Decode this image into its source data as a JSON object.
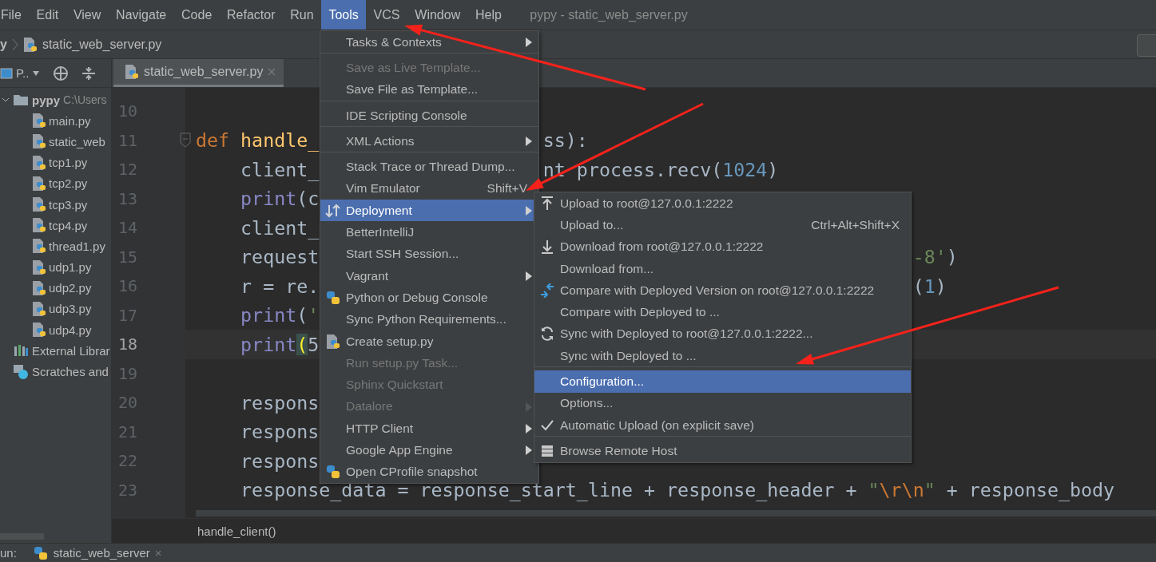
{
  "menu_bar": {
    "items": [
      {
        "label": "File",
        "selected": false
      },
      {
        "label": "Edit",
        "selected": false
      },
      {
        "label": "View",
        "selected": false
      },
      {
        "label": "Navigate",
        "selected": false
      },
      {
        "label": "Code",
        "selected": false
      },
      {
        "label": "Refactor",
        "selected": false
      },
      {
        "label": "Run",
        "selected": false
      },
      {
        "label": "Tools",
        "selected": true
      },
      {
        "label": "VCS",
        "selected": false
      },
      {
        "label": "Window",
        "selected": false
      },
      {
        "label": "Help",
        "selected": false
      }
    ],
    "window_title": "pypy - static_web_server.py"
  },
  "navigation_bar": {
    "path": [
      "y",
      "static_web_server.py"
    ]
  },
  "project_panel": {
    "title": "P..",
    "tree": [
      {
        "label": "pypy",
        "path": "C:\\Users",
        "kind": "folder",
        "expanded": true,
        "children": [
          {
            "label": "main.py",
            "kind": "python"
          },
          {
            "label": "static_web",
            "kind": "python"
          },
          {
            "label": "tcp1.py",
            "kind": "python"
          },
          {
            "label": "tcp2.py",
            "kind": "python"
          },
          {
            "label": "tcp3.py",
            "kind": "python"
          },
          {
            "label": "tcp4.py",
            "kind": "python"
          },
          {
            "label": "thread1.py",
            "kind": "python"
          },
          {
            "label": "udp1.py",
            "kind": "python"
          },
          {
            "label": "udp2.py",
            "kind": "python"
          },
          {
            "label": "udp3.py",
            "kind": "python"
          },
          {
            "label": "udp4.py",
            "kind": "python"
          }
        ]
      },
      {
        "label": "External Librar",
        "kind": "library"
      },
      {
        "label": "Scratches and",
        "kind": "scratches"
      }
    ]
  },
  "editor_tabs": [
    {
      "label": "static_web_server.py",
      "selected": true
    }
  ],
  "code_lines": [
    {
      "number": "10",
      "current": false
    },
    {
      "number": "11",
      "current": false,
      "left": [
        {
          "text": "def",
          "kind": "keyword"
        },
        {
          "text": "handle_",
          "kind": "function"
        }
      ],
      "right": [
        {
          "text": "ss):",
          "kind": "plain"
        }
      ]
    },
    {
      "number": "12",
      "current": false,
      "left": [
        {
          "text": "client_",
          "kind": "plain"
        }
      ],
      "right": [
        {
          "text": "nt process.recv(",
          "kind": "plain"
        },
        {
          "text": "1024",
          "kind": "number"
        },
        {
          "text": ")",
          "kind": "plain"
        }
      ]
    },
    {
      "number": "13",
      "current": false,
      "left": [
        {
          "text": "print",
          "kind": "builtin"
        },
        {
          "text": "(c",
          "kind": "plain"
        }
      ]
    },
    {
      "number": "14",
      "current": false,
      "left": [
        {
          "text": "client_",
          "kind": "plain"
        }
      ]
    },
    {
      "number": "15",
      "current": false,
      "left": [
        {
          "text": "request",
          "kind": "plain"
        }
      ],
      "right": [
        {
          "text": "-8'",
          "kind": "string"
        },
        {
          "text": ")",
          "kind": "plain"
        }
      ]
    },
    {
      "number": "16",
      "current": false,
      "left": [
        {
          "text": "r = re.",
          "kind": "plain"
        }
      ],
      "right": [
        {
          "text": "(",
          "kind": "plain"
        },
        {
          "text": "1",
          "kind": "number"
        },
        {
          "text": ")",
          "kind": "plain"
        }
      ]
    },
    {
      "number": "17",
      "current": false,
      "left": [
        {
          "text": "print",
          "kind": "builtin"
        },
        {
          "text": "(",
          "kind": "plain"
        },
        {
          "text": "'",
          "kind": "string"
        }
      ]
    },
    {
      "number": "18",
      "current": true,
      "left": [
        {
          "text": "print",
          "kind": "builtin"
        },
        {
          "text": "(",
          "kind": "brace"
        },
        {
          "text": "5",
          "kind": "plain"
        }
      ]
    },
    {
      "number": "19",
      "current": false
    },
    {
      "number": "20",
      "current": false,
      "left": [
        {
          "text": "respons",
          "kind": "plain"
        }
      ]
    },
    {
      "number": "21",
      "current": false,
      "left": [
        {
          "text": "respons",
          "kind": "plain"
        }
      ]
    },
    {
      "number": "22",
      "current": false,
      "left": [
        {
          "text": "respons",
          "kind": "plain"
        }
      ]
    },
    {
      "number": "23",
      "current": false,
      "left": [
        {
          "text": "response_data = response_start_line + response_header + ",
          "kind": "plain"
        },
        {
          "text": "\"",
          "kind": "string"
        },
        {
          "text": "\\r\\n",
          "kind": "escape"
        },
        {
          "text": "\"",
          "kind": "string"
        },
        {
          "text": " + response_body",
          "kind": "plain"
        }
      ]
    }
  ],
  "breadcrumb": "handle_client()",
  "run_bar": {
    "label": "un:",
    "tab": "static_web_server",
    "close": "×"
  },
  "tools_menu": {
    "items": [
      {
        "label": "Tasks & Contexts",
        "submenu": true,
        "disabled": false,
        "selected": false,
        "separator_after": true
      },
      {
        "label": "Save as Live Template...",
        "submenu": false,
        "disabled": true,
        "selected": false,
        "separator_after": false
      },
      {
        "label": "Save File as Template...",
        "submenu": false,
        "disabled": false,
        "selected": false,
        "separator_after": true
      },
      {
        "label": "IDE Scripting Console",
        "submenu": false,
        "disabled": false,
        "selected": false,
        "separator_after": true
      },
      {
        "label": "XML Actions",
        "submenu": true,
        "disabled": false,
        "selected": false,
        "separator_after": true
      },
      {
        "label": "Stack Trace or Thread Dump...",
        "submenu": false,
        "disabled": false,
        "selected": false,
        "separator_after": false
      },
      {
        "label": "Vim Emulator",
        "shortcut": "Shift+V",
        "submenu": false,
        "disabled": false,
        "selected": false,
        "separator_after": false
      },
      {
        "label": "Deployment",
        "kind": "deploy",
        "submenu": true,
        "disabled": false,
        "selected": true,
        "separator_after": false
      },
      {
        "label": "BetterIntelliJ",
        "submenu": false,
        "disabled": false,
        "selected": false,
        "separator_after": false
      },
      {
        "label": "Start SSH Session...",
        "submenu": false,
        "disabled": false,
        "selected": false,
        "separator_after": false
      },
      {
        "label": "Vagrant",
        "submenu": true,
        "disabled": false,
        "selected": false,
        "separator_after": false
      },
      {
        "label": "Python or Debug Console",
        "kind": "python",
        "submenu": false,
        "disabled": false,
        "selected": false,
        "separator_after": false
      },
      {
        "label": "Sync Python Requirements...",
        "submenu": false,
        "disabled": false,
        "selected": false,
        "separator_after": false
      },
      {
        "label": "Create setup.py",
        "kind": "pyfile",
        "submenu": false,
        "disabled": false,
        "selected": false,
        "separator_after": false
      },
      {
        "label": "Run setup.py Task...",
        "submenu": false,
        "disabled": true,
        "selected": false,
        "separator_after": false
      },
      {
        "label": "Sphinx Quickstart",
        "submenu": false,
        "disabled": true,
        "selected": false,
        "separator_after": false
      },
      {
        "label": "Datalore",
        "submenu": true,
        "disabled": true,
        "selected": false,
        "separator_after": false
      },
      {
        "label": "HTTP Client",
        "submenu": true,
        "disabled": false,
        "selected": false,
        "separator_after": false
      },
      {
        "label": "Google App Engine",
        "submenu": true,
        "disabled": false,
        "selected": false,
        "separator_after": false
      },
      {
        "label": "Open CProfile snapshot",
        "kind": "profile",
        "submenu": false,
        "disabled": false,
        "selected": false,
        "separator_after": false
      }
    ]
  },
  "deployment_submenu": {
    "items": [
      {
        "label": "Upload to root@127.0.0.1:2222",
        "kind": "upload",
        "checked": false,
        "selected": false,
        "separator_after": false
      },
      {
        "label": "Upload to...",
        "shortcut": "Ctrl+Alt+Shift+X",
        "checked": false,
        "selected": false,
        "separator_after": false
      },
      {
        "label": "Download from root@127.0.0.1:2222",
        "kind": "download",
        "checked": false,
        "selected": false,
        "separator_after": false
      },
      {
        "label": "Download from...",
        "checked": false,
        "selected": false,
        "separator_after": false
      },
      {
        "label": "Compare with Deployed Version on root@127.0.0.1:2222",
        "kind": "compare",
        "checked": false,
        "selected": false,
        "separator_after": false
      },
      {
        "label": "Compare with Deployed to ...",
        "checked": false,
        "selected": false,
        "separator_after": false
      },
      {
        "label": "Sync with Deployed to root@127.0.0.1:2222...",
        "kind": "sync",
        "checked": false,
        "selected": false,
        "separator_after": false
      },
      {
        "label": "Sync with Deployed to ...",
        "checked": false,
        "selected": false,
        "separator_after": true
      },
      {
        "label": "Configuration...",
        "checked": false,
        "selected": true,
        "separator_after": false
      },
      {
        "label": "Options...",
        "checked": false,
        "selected": false,
        "separator_after": false
      },
      {
        "label": "Automatic Upload (on explicit save)",
        "checked": true,
        "selected": false,
        "separator_after": true
      },
      {
        "label": "Browse Remote Host",
        "kind": "server",
        "checked": false,
        "selected": false,
        "separator_after": false
      }
    ]
  }
}
